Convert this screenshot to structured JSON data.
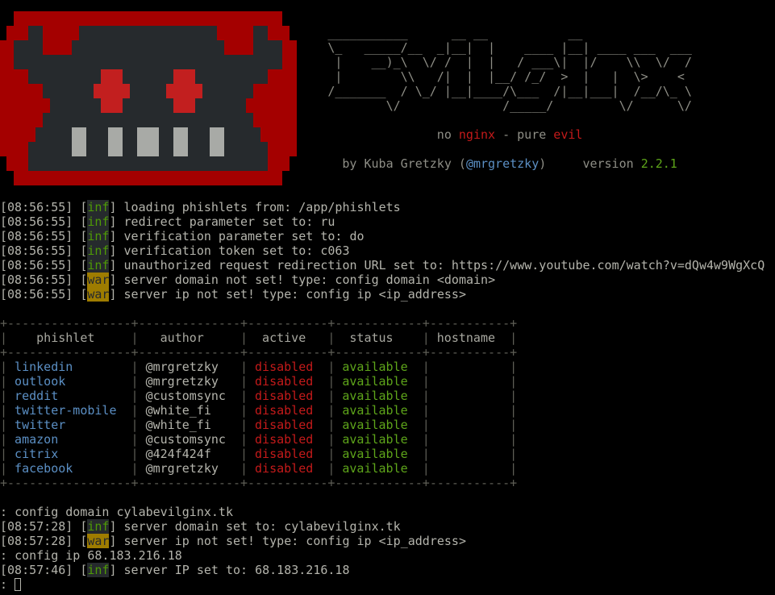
{
  "banner": {
    "art": [
      "___________      __ __           __",
      "\\_   _____/__  _|__|  |    ____ |__| ____ ___  ___",
      " |    __)_\\  \\/ /  |  |   / ___\\|  |/    \\\\  \\/  /",
      " |        \\\\   /|  |  |__/ /_/  >  |   |  \\>    <",
      "/_______  / \\_/ |__|____/\\___  /|__|___|  /__/\\_ \\",
      "        \\/              /_____/         \\/      \\/"
    ],
    "tagline": {
      "no": "no",
      "nginx": "nginx",
      "dash": "-",
      "pure": "pure",
      "evil": "evil"
    },
    "credits": {
      "by": "by Kuba Gretzky (",
      "handle": "@mrgretzky",
      "close": ")",
      "version_label": "version",
      "version": "2.2.1"
    }
  },
  "log": [
    {
      "time": "[08:56:55]",
      "level": "inf",
      "msg": "loading phishlets from: /app/phishlets"
    },
    {
      "time": "[08:56:55]",
      "level": "inf",
      "msg": "redirect parameter set to: ru"
    },
    {
      "time": "[08:56:55]",
      "level": "inf",
      "msg": "verification parameter set to: do"
    },
    {
      "time": "[08:56:55]",
      "level": "inf",
      "msg": "verification token set to: c063"
    },
    {
      "time": "[08:56:55]",
      "level": "inf",
      "msg": "unauthorized request redirection URL set to: https://www.youtube.com/watch?v=dQw4w9WgXcQ"
    },
    {
      "time": "[08:56:55]",
      "level": "war",
      "msg": "server domain not set! type: config domain <domain>"
    },
    {
      "time": "[08:56:55]",
      "level": "war",
      "msg": "server ip not set! type: config ip <ip_address>"
    }
  ],
  "table": {
    "headers": [
      "phishlet",
      "author",
      "active",
      "status",
      "hostname"
    ],
    "rows": [
      {
        "phishlet": "linkedin",
        "author": "@mrgretzky",
        "active": "disabled",
        "status": "available",
        "hostname": ""
      },
      {
        "phishlet": "outlook",
        "author": "@mrgretzky",
        "active": "disabled",
        "status": "available",
        "hostname": ""
      },
      {
        "phishlet": "reddit",
        "author": "@customsync",
        "active": "disabled",
        "status": "available",
        "hostname": ""
      },
      {
        "phishlet": "twitter-mobile",
        "author": "@white_fi",
        "active": "disabled",
        "status": "available",
        "hostname": ""
      },
      {
        "phishlet": "twitter",
        "author": "@white_fi",
        "active": "disabled",
        "status": "available",
        "hostname": ""
      },
      {
        "phishlet": "amazon",
        "author": "@customsync",
        "active": "disabled",
        "status": "available",
        "hostname": ""
      },
      {
        "phishlet": "citrix",
        "author": "@424f424f",
        "active": "disabled",
        "status": "available",
        "hostname": ""
      },
      {
        "phishlet": "facebook",
        "author": "@mrgretzky",
        "active": "disabled",
        "status": "available",
        "hostname": ""
      }
    ]
  },
  "session": [
    {
      "type": "cmd",
      "prompt": ":",
      "text": "config domain cylabevilginx.tk"
    },
    {
      "type": "log",
      "time": "[08:57:28]",
      "level": "inf",
      "msg": "server domain set to: cylabevilginx.tk"
    },
    {
      "type": "log",
      "time": "[08:57:28]",
      "level": "war",
      "msg": "server ip not set! type: config ip <ip_address>"
    },
    {
      "type": "cmd",
      "prompt": ":",
      "text": "config ip 68.183.216.18"
    },
    {
      "type": "log",
      "time": "[08:57:46]",
      "level": "inf",
      "msg": "server IP set to: 68.183.216.18"
    }
  ],
  "prompt": {
    "symbol": ":",
    "input": ""
  },
  "colors": {
    "logo_red": "#a40000",
    "logo_dark": "#262a2d",
    "logo_eye": "#c21f1f",
    "logo_teeth": "#a8aaa6",
    "inf_bg": "#262a2d",
    "war_bg": "#9e7c00",
    "error_red": "#c41a1a",
    "ok_green": "#5ea51a",
    "link_blue": "#5b8fc4"
  }
}
